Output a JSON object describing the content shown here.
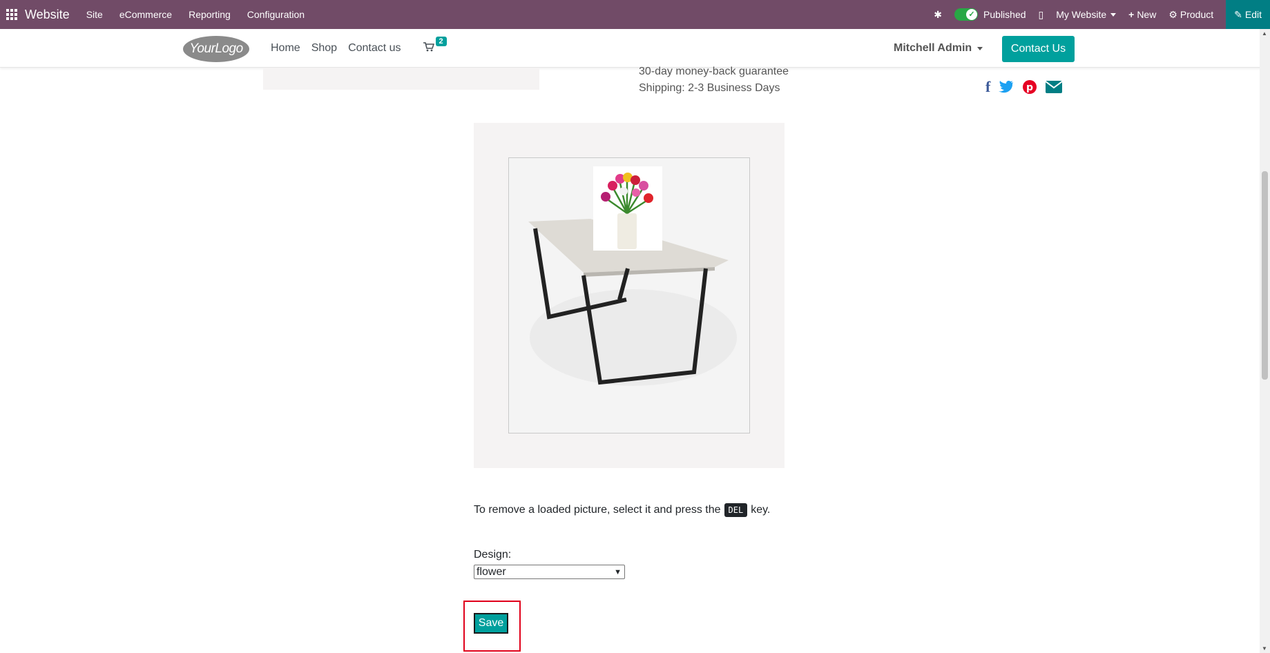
{
  "topbar": {
    "brand": "Website",
    "menus": [
      "Site",
      "eCommerce",
      "Reporting",
      "Configuration"
    ],
    "published_label": "Published",
    "website_label": "My Website",
    "new_label": "New",
    "product_label": "Product",
    "edit_label": "Edit"
  },
  "header": {
    "logo_text": "YourLogo",
    "nav": [
      "Home",
      "Shop",
      "Contact us"
    ],
    "cart_count": "2",
    "user_name": "Mitchell Admin",
    "contact_button": "Contact Us"
  },
  "product": {
    "guarantee": "30-day money-back guarantee",
    "shipping": "Shipping: 2-3 Business Days"
  },
  "editor": {
    "hint_before": "To remove a loaded picture, select it and press the",
    "hint_key": "DEL",
    "hint_after": "key.",
    "design_label": "Design:",
    "design_value": "flower",
    "save_label": "Save"
  },
  "colors": {
    "topbar": "#714b67",
    "accent": "#00a09d",
    "highlight": "#e0001a"
  }
}
